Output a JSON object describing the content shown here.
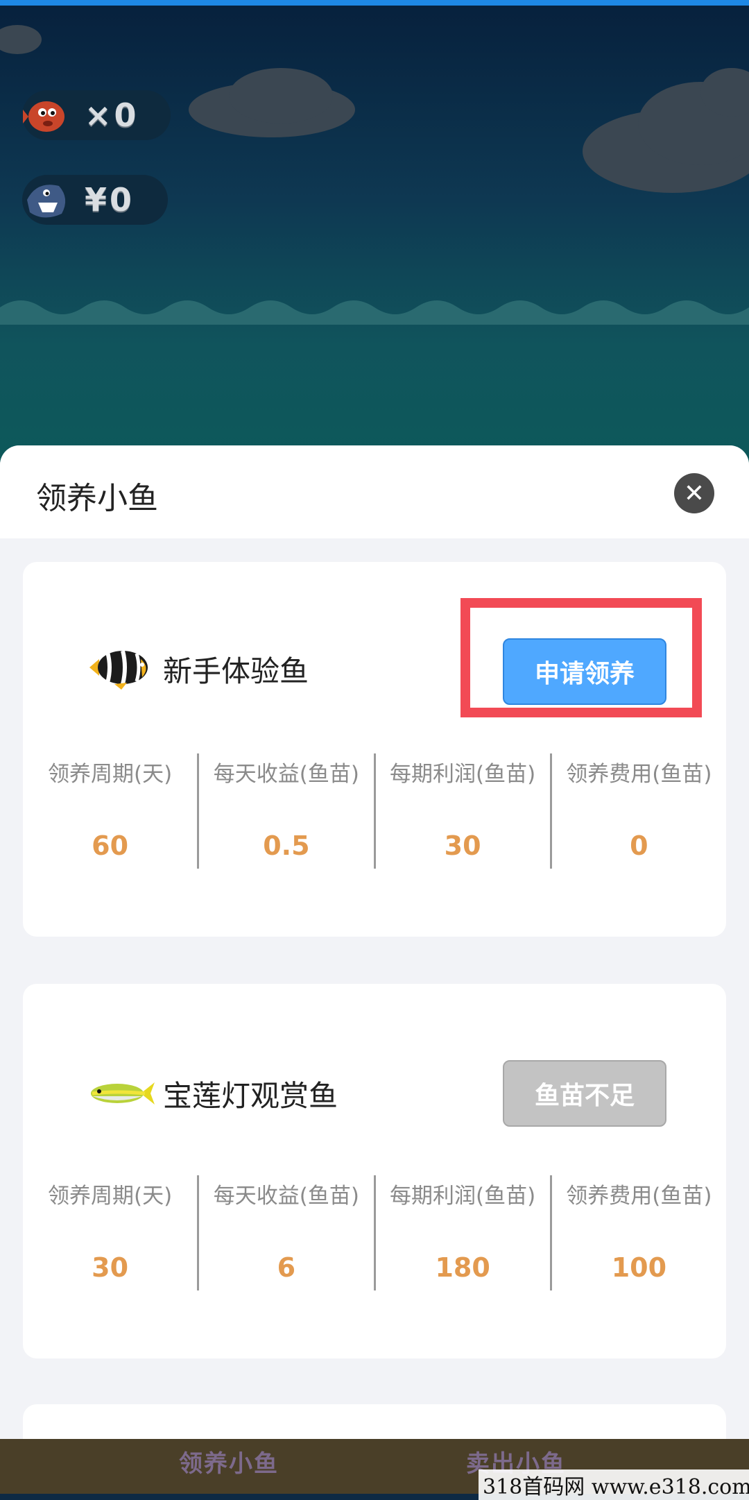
{
  "game": {
    "fish_counter": "×0",
    "money_counter": "¥0"
  },
  "sheet": {
    "title": "领养小鱼",
    "close_icon": "close-icon"
  },
  "cards": [
    {
      "name": "新手体验鱼",
      "button": "申请领养",
      "button_state": "enabled",
      "labels": [
        "领养周期(天)",
        "每天收益(鱼苗)",
        "每期利润(鱼苗)",
        "领养费用(鱼苗)"
      ],
      "values": [
        "60",
        "0.5",
        "30",
        "0"
      ]
    },
    {
      "name": "宝莲灯观赏鱼",
      "button": "鱼苗不足",
      "button_state": "disabled",
      "labels": [
        "领养周期(天)",
        "每天收益(鱼苗)",
        "每期利润(鱼苗)",
        "领养费用(鱼苗)"
      ],
      "values": [
        "30",
        "6",
        "180",
        "100"
      ]
    }
  ],
  "bottom_nav": {
    "left": "领养小鱼",
    "right": "卖出小鱼"
  },
  "watermark": "318首码网 www.e318.com",
  "colors": {
    "accent": "#4fa8ff",
    "value": "#e39a4f",
    "highlight": "#f24a55"
  }
}
